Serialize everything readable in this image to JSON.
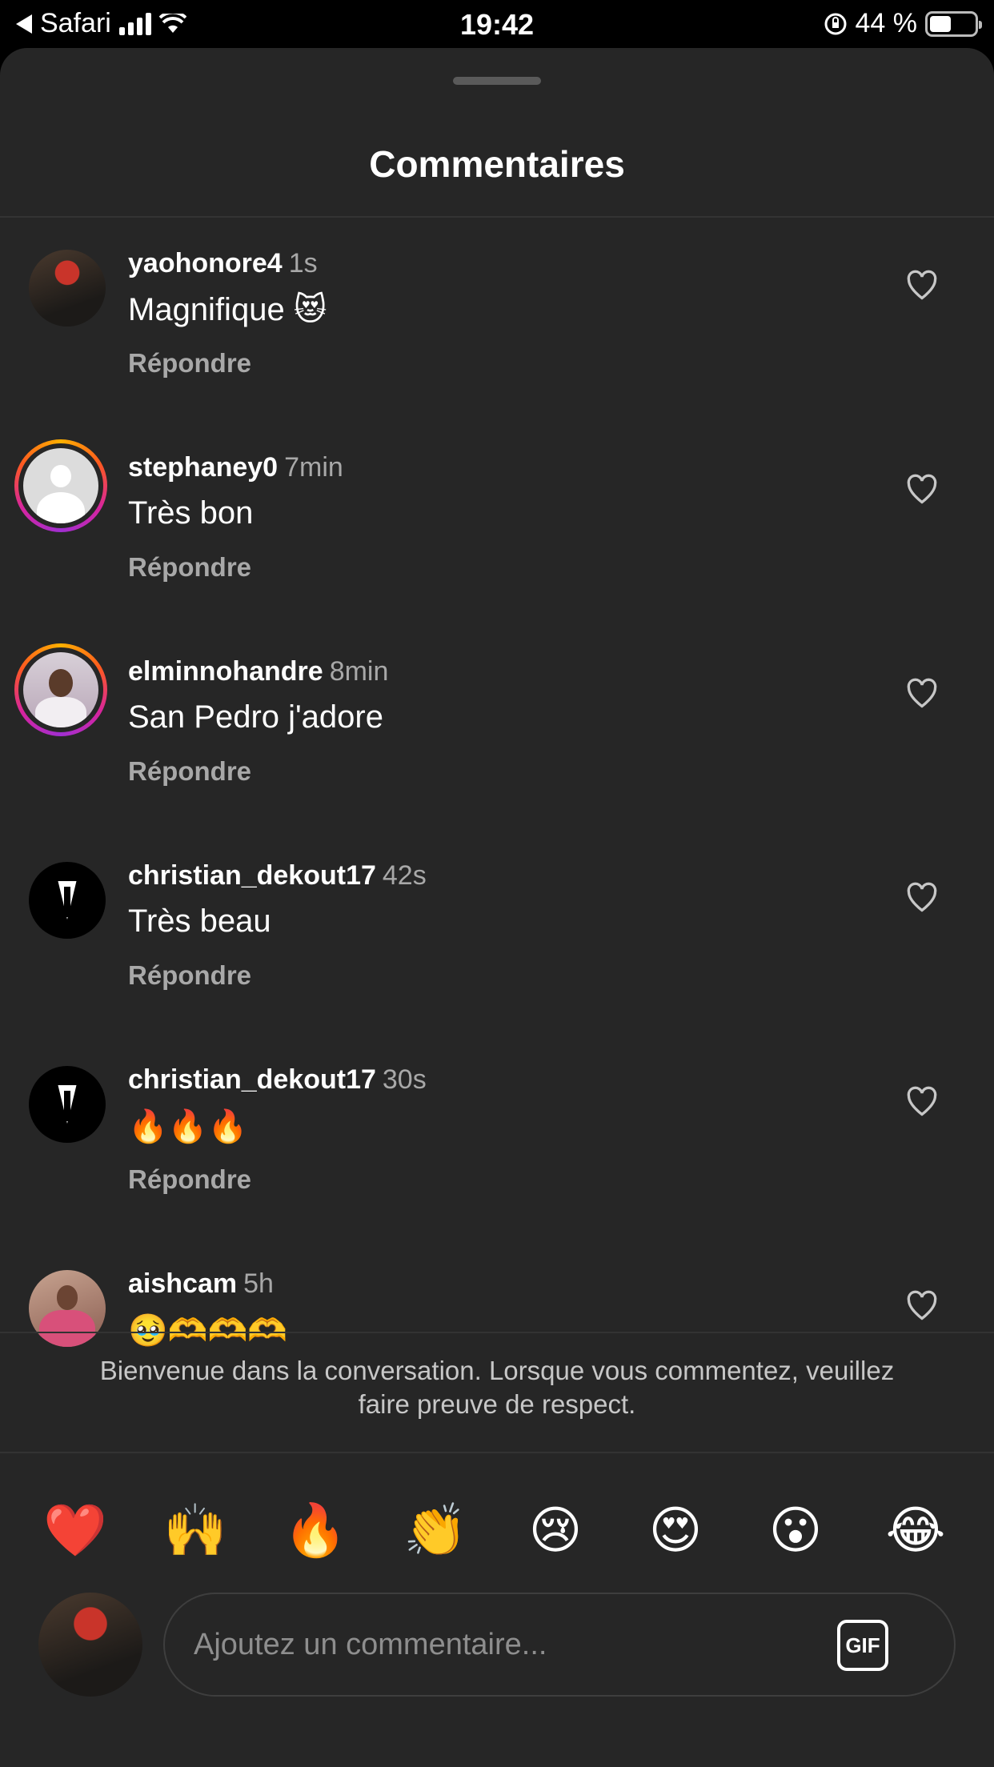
{
  "status_bar": {
    "back_app": "Safari",
    "time": "19:42",
    "battery_percent": "44 %",
    "battery_level": 0.44
  },
  "sheet": {
    "title": "Commentaires"
  },
  "comments": [
    {
      "username": "yaohonore4",
      "time": "1s",
      "text": "Magnifique 😻",
      "reply_label": "Répondre",
      "avatar": "red-hat-photo"
    },
    {
      "username": "stephaney0",
      "time": "7min",
      "text": "Très bon",
      "reply_label": "Répondre",
      "avatar": "default-avatar"
    },
    {
      "username": "elminnohandre",
      "time": "8min",
      "text": "San Pedro j'adore",
      "reply_label": "Répondre",
      "avatar": "man-photo"
    },
    {
      "username": "christian_dekout17",
      "time": "42s",
      "text": "Très beau",
      "reply_label": "Répondre",
      "avatar": "suit-logo"
    },
    {
      "username": "christian_dekout17",
      "time": "30s",
      "text": "🔥🔥🔥",
      "reply_label": "Répondre",
      "avatar": "suit-logo"
    },
    {
      "username": "aishcam",
      "time": "5h",
      "text": "🥹🫶🫶🫶",
      "reply_label": "",
      "avatar": "woman-photo"
    }
  ],
  "welcome_text": "Bienvenue dans la conversation. Lorsque vous commentez, veuillez faire preuve de respect.",
  "quick_emojis": [
    "❤️",
    "🙌",
    "🔥",
    "👏",
    "😢",
    "😍",
    "😮",
    "😂"
  ],
  "composer": {
    "placeholder": "Ajoutez un commentaire...",
    "gif_label": "GIF"
  },
  "colors": {
    "sheet_bg": "#262626",
    "secondary_text": "#a8a8a8",
    "story_ring": "#d6249f"
  }
}
